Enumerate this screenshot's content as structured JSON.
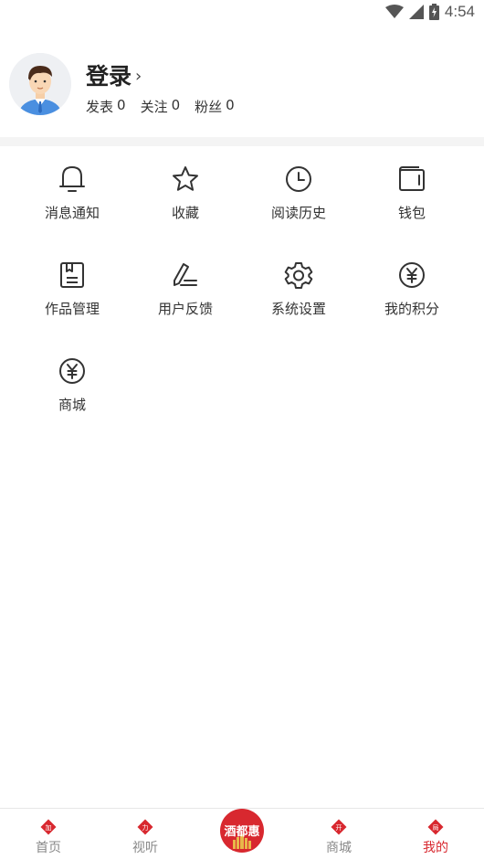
{
  "status_bar": {
    "time": "4:54",
    "icons": [
      "wifi-icon",
      "signal-icon",
      "battery-icon"
    ]
  },
  "profile": {
    "login_label": "登录",
    "chevron": "›",
    "stats": [
      {
        "label": "发表",
        "value": "0"
      },
      {
        "label": "关注",
        "value": "0"
      },
      {
        "label": "粉丝",
        "value": "0"
      }
    ]
  },
  "menu": {
    "items": [
      {
        "label": "消息通知",
        "icon": "bell-icon"
      },
      {
        "label": "收藏",
        "icon": "star-icon"
      },
      {
        "label": "阅读历史",
        "icon": "clock-icon"
      },
      {
        "label": "钱包",
        "icon": "wallet-icon"
      },
      {
        "label": "作品管理",
        "icon": "document-icon"
      },
      {
        "label": "用户反馈",
        "icon": "pen-icon"
      },
      {
        "label": "系统设置",
        "icon": "gear-icon"
      },
      {
        "label": "我的积分",
        "icon": "yen-coin-icon"
      },
      {
        "label": "商城",
        "icon": "yen-coin-icon"
      }
    ]
  },
  "bottom_nav": {
    "items": [
      {
        "label": "首页",
        "badge": "加",
        "active": false
      },
      {
        "label": "视听",
        "badge": "力",
        "active": false
      },
      {
        "label": "商城",
        "badge": "开",
        "active": false
      },
      {
        "label": "我的",
        "badge": "局",
        "active": true
      }
    ],
    "center_logo_text": "酒都惠"
  },
  "colors": {
    "accent": "#d8282f",
    "text_primary": "#222222",
    "text_secondary": "#888888",
    "icon_stroke": "#333333"
  }
}
